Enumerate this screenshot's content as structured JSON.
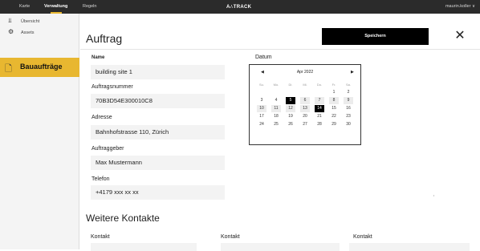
{
  "topbar": {
    "nav_karte": "Karte",
    "nav_verwaltung": "Verwaltung",
    "nav_regeln": "Regeln",
    "logo": "A∴TRACK",
    "user": "maurin.koller ∨",
    "accent_color": "#e8b730"
  },
  "sidebar": {
    "items": [
      {
        "label": "Übersicht",
        "icon": "overview-icon"
      },
      {
        "label": "Assets",
        "icon": "assets-icon"
      },
      {
        "label": "Bauaufträge",
        "icon": "construction-orders-icon",
        "active": true
      }
    ]
  },
  "main": {
    "title": "Auftrag",
    "save_label": "Speichern",
    "close_icon": "close-icon"
  },
  "form": {
    "name_label": "Name",
    "name_value": "building site 1",
    "order_number_label": "Auftragsnummer",
    "order_number_value": "70B3D54E300010C8",
    "address_label": "Adresse",
    "address_value": "Bahnhofstrasse 110, Zürich",
    "client_label": "Auftraggeber",
    "client_value": "Max Mustermann",
    "phone_label": "Telefon",
    "phone_value": "+4179 xxx xx xx"
  },
  "datum": {
    "label": "Datum",
    "month": "Apr 2022",
    "prev": "◀",
    "next": "▶",
    "weekdays": [
      "Su.",
      "Mo.",
      "Di.",
      "Mi.",
      "Do.",
      "Fr.",
      "Sa."
    ],
    "days": [
      {
        "d": "",
        "t": "blank"
      },
      {
        "d": "",
        "t": "blank"
      },
      {
        "d": "",
        "t": "blank"
      },
      {
        "d": "",
        "t": "blank"
      },
      {
        "d": "",
        "t": "blank"
      },
      {
        "d": "1",
        "t": ""
      },
      {
        "d": "2",
        "t": ""
      },
      {
        "d": "3",
        "t": ""
      },
      {
        "d": "4",
        "t": ""
      },
      {
        "d": "5",
        "t": "sel"
      },
      {
        "d": "6",
        "t": "out"
      },
      {
        "d": "7",
        "t": "out"
      },
      {
        "d": "8",
        "t": "out"
      },
      {
        "d": "9",
        "t": "out"
      },
      {
        "d": "10",
        "t": "out"
      },
      {
        "d": "11",
        "t": "out"
      },
      {
        "d": "12",
        "t": "out"
      },
      {
        "d": "13",
        "t": "out"
      },
      {
        "d": "14",
        "t": "sel"
      },
      {
        "d": "15",
        "t": ""
      },
      {
        "d": "16",
        "t": ""
      },
      {
        "d": "17",
        "t": ""
      },
      {
        "d": "18",
        "t": ""
      },
      {
        "d": "19",
        "t": ""
      },
      {
        "d": "20",
        "t": ""
      },
      {
        "d": "21",
        "t": ""
      },
      {
        "d": "22",
        "t": ""
      },
      {
        "d": "23",
        "t": ""
      },
      {
        "d": "24",
        "t": ""
      },
      {
        "d": "25",
        "t": ""
      },
      {
        "d": "26",
        "t": ""
      },
      {
        "d": "27",
        "t": ""
      },
      {
        "d": "28",
        "t": ""
      },
      {
        "d": "29",
        "t": ""
      },
      {
        "d": "30",
        "t": ""
      }
    ]
  },
  "kontakte": {
    "title": "Weitere Kontakte",
    "labels": [
      "Kontakt",
      "Kontakt",
      "Kontakt"
    ]
  }
}
